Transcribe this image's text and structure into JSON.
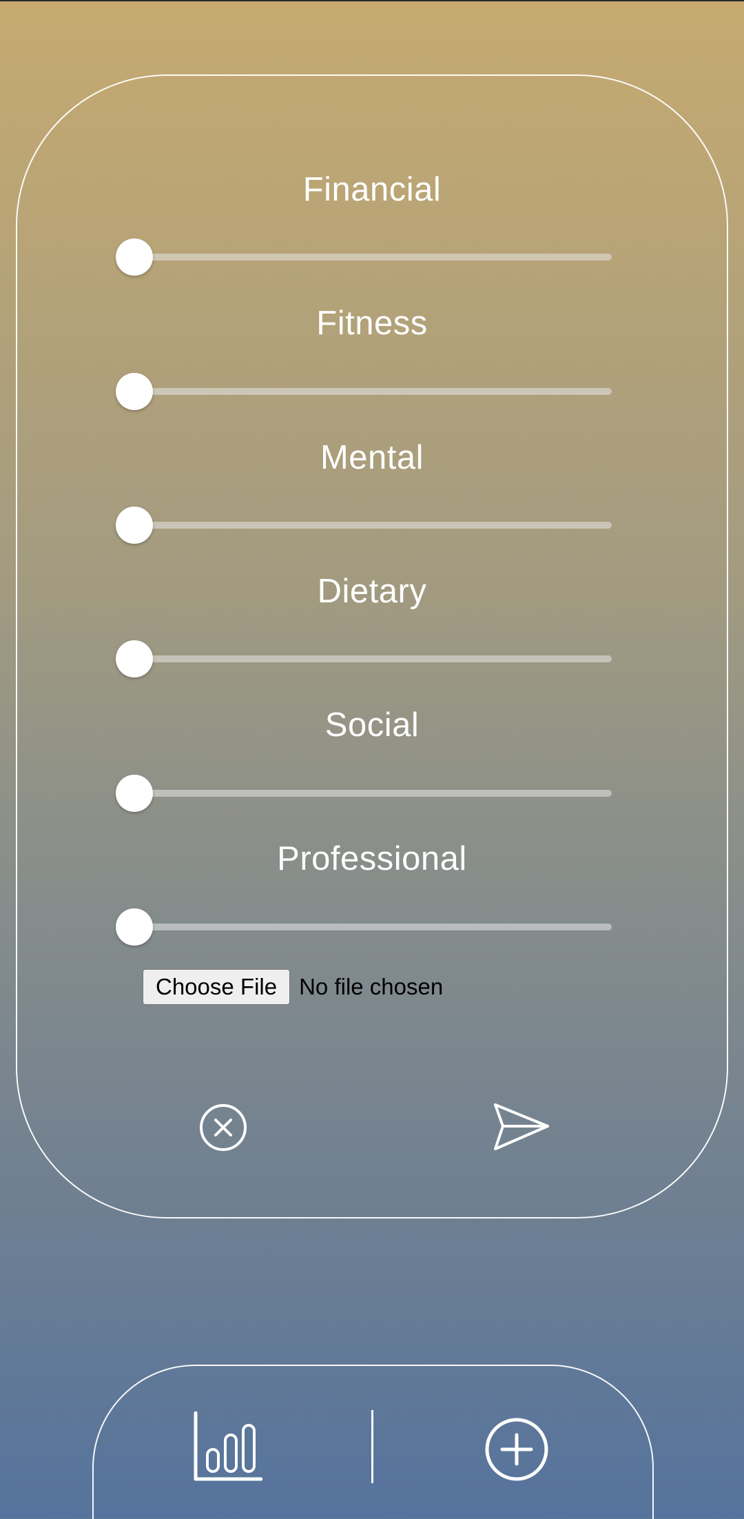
{
  "form": {
    "sliders": [
      {
        "label": "Financial",
        "value": 0
      },
      {
        "label": "Fitness",
        "value": 0
      },
      {
        "label": "Mental",
        "value": 0
      },
      {
        "label": "Dietary",
        "value": 0
      },
      {
        "label": "Social",
        "value": 0
      },
      {
        "label": "Professional",
        "value": 0
      }
    ],
    "file_input": {
      "button_label": "Choose File",
      "status": "No file chosen"
    },
    "actions": {
      "cancel_icon": "close-circle-icon",
      "submit_icon": "send-icon"
    }
  },
  "bottom_nav": {
    "left_icon": "bar-chart-icon",
    "right_icon": "add-circle-icon"
  },
  "colors": {
    "gradient_top": "#c6aa70",
    "gradient_bottom": "#55739d",
    "foreground": "#ffffff"
  }
}
